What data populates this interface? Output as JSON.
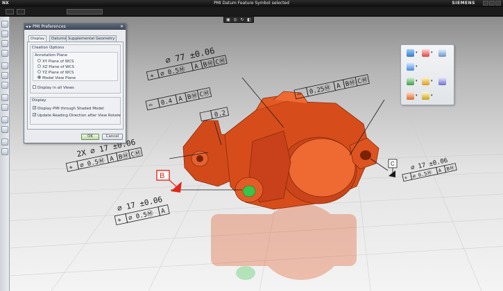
{
  "window": {
    "app_name": "NX",
    "status_title": "PMI Datum Feature Symbol selected",
    "brand": "SIEMENS"
  },
  "dialog": {
    "title": "PMI Preferences",
    "tabs": [
      "Display",
      "Datums",
      "Supplemental Geometry"
    ],
    "active_tab": "Display",
    "creation_options": {
      "label": "Creation Options",
      "annotation_plane_label": "Annotation Plane",
      "planes": [
        {
          "label": "XY Plane of WCS",
          "selected": false
        },
        {
          "label": "XZ Plane of WCS",
          "selected": false
        },
        {
          "label": "YZ Plane of WCS",
          "selected": false
        },
        {
          "label": "Model View Plane",
          "selected": true
        }
      ],
      "display_in_all_views": {
        "label": "Display in all Views",
        "checked": false
      }
    },
    "display": {
      "label": "Display",
      "options": [
        {
          "label": "Display PMI through Shaded Model",
          "checked": true
        },
        {
          "label": "Update Reading Direction after View Rotate",
          "checked": true
        }
      ]
    },
    "ok_label": "OK",
    "cancel_label": "Cancel"
  },
  "pmi": {
    "top_dim": "⌀ 77 ±0.06",
    "top_fcf": [
      "⌖",
      "⌀ 0.5Ⓜ",
      "A",
      "BⓂ",
      "CⓂ"
    ],
    "upper_fcf": [
      "⌓",
      "0.4",
      "A",
      "BⓂ",
      "CⓂ"
    ],
    "right_fcf": [
      "⌓",
      "0.25Ⓜ",
      "A",
      "BⓂ",
      "CⓂ"
    ],
    "small_box": "0.2",
    "left_dim": "2X ⌀ 17 ±0.06",
    "left_fcf": [
      "⌖",
      "⌀ 0.5Ⓜ",
      "A",
      "BⓂ",
      "CⓂ"
    ],
    "bottom_dim": "⌀ 17 ±0.06",
    "bottom_fcf": [
      "⌖",
      "⌀ 0.5Ⓜ",
      "A"
    ],
    "right_dim": "⌀ 17 ±0.06",
    "right_dim_fcf": [
      "⌖",
      "⌀ 0.5Ⓜ",
      "A",
      "BⓂ"
    ],
    "datum_b": "B",
    "datum_c": "C"
  },
  "colors": {
    "part": "#e0531e",
    "part_dark": "#a2330d",
    "datum_red": "#e3271b",
    "green_hole": "#39c44a"
  }
}
